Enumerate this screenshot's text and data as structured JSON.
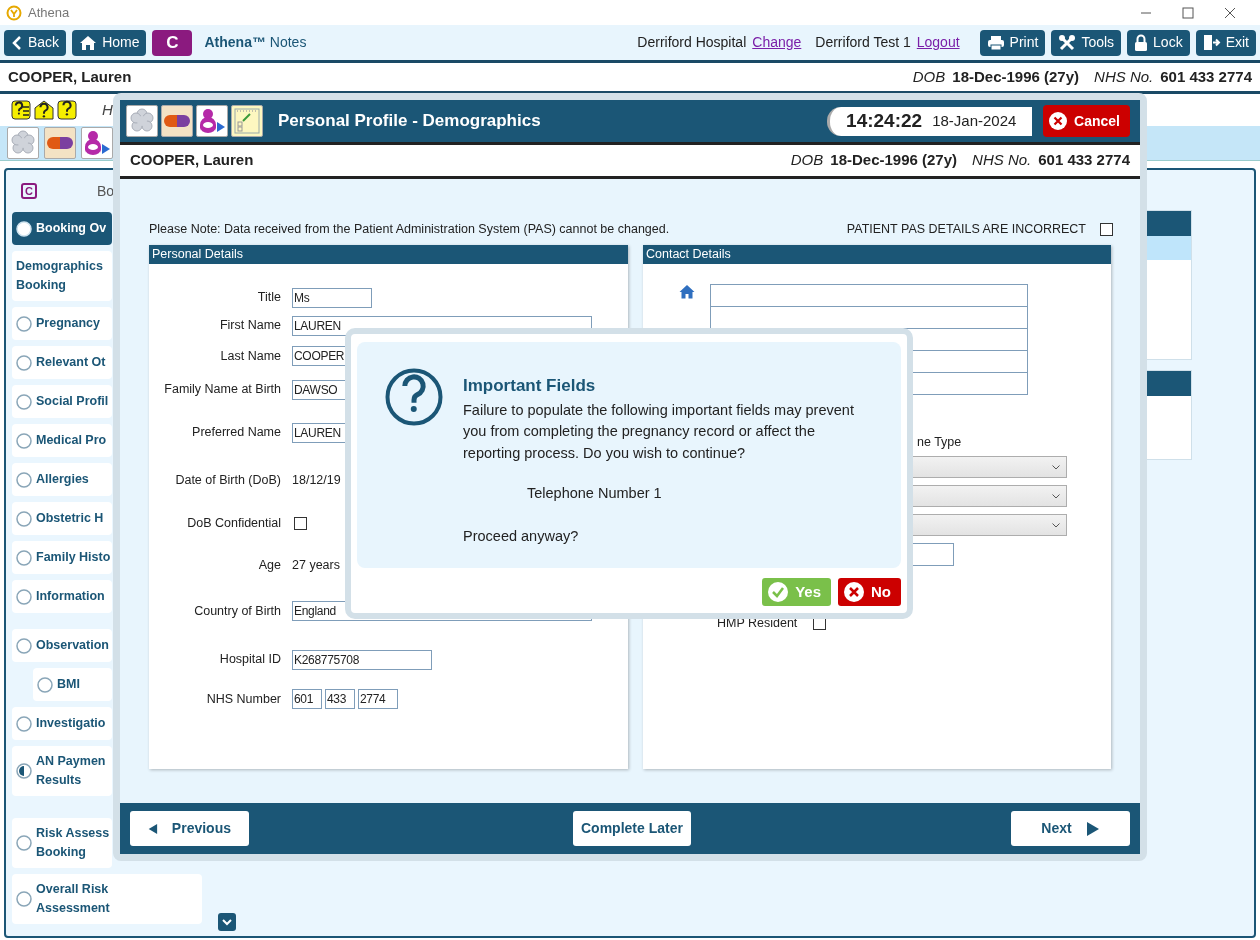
{
  "app_window": {
    "title": "Athena"
  },
  "toolbar": {
    "nav_buttons": [
      {
        "label": "Back"
      },
      {
        "label": "Home"
      }
    ],
    "module_badge": "C",
    "brand": "**Athena™** Notes",
    "site": "Derriford Hospital",
    "site_link": "Change",
    "user": "Derriford Test 1",
    "user_link": "Logout",
    "action_buttons": [
      {
        "label": "Print"
      },
      {
        "label": "Tools"
      },
      {
        "label": "Lock"
      },
      {
        "label": "Exit"
      }
    ]
  },
  "patient_banner": {
    "name": "COOPER, Lauren",
    "dob_label": "DOB",
    "dob": "18-Dec-1996 (27y)",
    "nhs_label": "NHS No.",
    "nhs": "601 433 2774"
  },
  "background": {
    "row_text": "H",
    "sidebar": {
      "badge": "C",
      "header": "Bo",
      "items": [
        {
          "kind": "radio",
          "label": "Booking Ov",
          "selected": true
        },
        {
          "kind": "plain",
          "label": "Demographics\nBooking",
          "selected": false
        },
        {
          "kind": "radio",
          "label": "Pregnancy",
          "selected": false
        },
        {
          "kind": "radio",
          "label": "Relevant Ot",
          "selected": false
        },
        {
          "kind": "radio",
          "label": "Social Profil",
          "selected": false
        },
        {
          "kind": "radio",
          "label": "Medical Pro",
          "selected": false
        },
        {
          "kind": "radio",
          "label": "Allergies",
          "selected": false
        },
        {
          "kind": "radio",
          "label": "Obstetric H",
          "selected": false
        },
        {
          "kind": "radio",
          "label": "Family Histo",
          "selected": false
        },
        {
          "kind": "radio",
          "label": "Information",
          "selected": false
        },
        {
          "kind": "radio",
          "label": "Observation",
          "selected": false,
          "children": [
            {
              "kind": "radio",
              "label": "BMI",
              "selected": false
            }
          ]
        },
        {
          "kind": "radio",
          "label": "Investigatio",
          "selected": false
        },
        {
          "kind": "half",
          "label": "AN Paymen\nResults",
          "selected": false
        },
        {
          "kind": "radio",
          "label": "Risk Assess\nBooking",
          "selected": false
        },
        {
          "kind": "radio",
          "label": "Overall Risk\nAssessment",
          "selected": false
        }
      ]
    }
  },
  "modal": {
    "title": "Personal Profile - Demographics",
    "time": "14:24:22",
    "date": "18-Jan-2024",
    "cancel": "Cancel",
    "patient": {
      "name": "COOPER, Lauren",
      "dob_label": "DOB",
      "dob": "18-Dec-1996 (27y)",
      "nhs_label": "NHS No.",
      "nhs": "601 433 2774"
    },
    "note": "Please Note:  Data received from the Patient Administration System (PAS) cannot be changed.",
    "pas_flag": {
      "label": "PATIENT PAS DETAILS ARE INCORRECT",
      "checked": false
    },
    "personal_details": {
      "title": "Personal Details",
      "rows": [
        {
          "kind": "field",
          "label": "Title",
          "value": "Ms"
        },
        {
          "kind": "field",
          "label": "First Name",
          "value": "LAUREN"
        },
        {
          "kind": "field",
          "label": "Last Name",
          "value": "COOPER"
        },
        {
          "kind": "field",
          "label": "Family Name at Birth",
          "value": "DAWSO"
        },
        {
          "kind": "field",
          "label": "Preferred Name",
          "value": "LAUREN"
        },
        {
          "kind": "text",
          "label": "Date of Birth (DoB)",
          "value": "18/12/19"
        },
        {
          "kind": "checkbox",
          "label": "DoB Confidential",
          "checked": false
        },
        {
          "kind": "text",
          "label": "Age",
          "value": "27 years"
        },
        {
          "kind": "field",
          "label": "Country of Birth",
          "value": "England"
        },
        {
          "kind": "field",
          "label": "Hospital ID",
          "value": "K268775708"
        },
        {
          "kind": "split",
          "label": "NHS Number",
          "parts": [
            "601",
            "433",
            "2774"
          ]
        }
      ]
    },
    "contact_details": {
      "title": "Contact Details",
      "phone_type_label": "ne Type",
      "hmp_resident": {
        "label": "HMP Resident",
        "checked": false
      }
    },
    "footer": {
      "previous": "Previous",
      "complete_later": "Complete Later",
      "next": "Next"
    }
  },
  "dialog": {
    "title": "Important Fields",
    "message": "Failure to populate the following important fields may prevent you from completing the pregnancy record or affect the reporting process.  Do you wish to continue?",
    "fields": [
      "Telephone Number 1"
    ],
    "question": "Proceed anyway?",
    "yes": "Yes",
    "no": "No"
  }
}
